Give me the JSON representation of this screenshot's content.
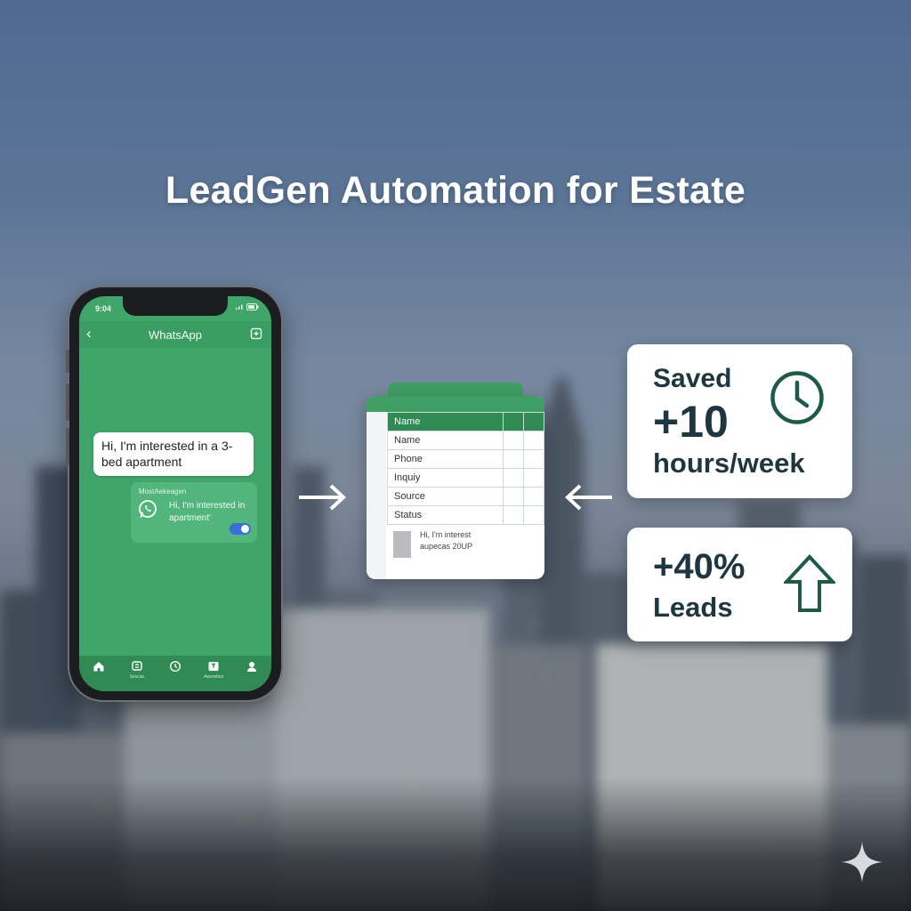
{
  "title": "LeadGen Automation for Estate",
  "phone": {
    "status_time": "9:04",
    "app_title": "WhatsApp",
    "incoming_message": "Hi, I'm interested in a 3-bed apartment",
    "outgoing_sender": "MostAekeagen",
    "outgoing_message": "Hi, I'm interested in apartment'",
    "nav_items": [
      {
        "icon": "home-icon",
        "label": ""
      },
      {
        "icon": "chats-icon",
        "label": "Sescas"
      },
      {
        "icon": "clock-icon",
        "label": ""
      },
      {
        "icon": "archive-icon",
        "label": "Awenetos"
      },
      {
        "icon": "profile-icon",
        "label": ""
      }
    ]
  },
  "sheet": {
    "header": "Name",
    "rows": [
      "Name",
      "Phone",
      "Inquiy",
      "Source",
      "Status"
    ],
    "footer_line1": "Hi, I'm interest",
    "footer_line2": "aupecas 20UP"
  },
  "stat_time": {
    "label_top": "Saved",
    "value": "+10",
    "label_bottom": "hours/week",
    "icon": "clock-icon"
  },
  "stat_leads": {
    "value": "+40%",
    "label": "Leads",
    "icon": "up-arrow-icon"
  },
  "colors": {
    "green": "#3fa568",
    "dark_green": "#2f8a53",
    "icon_green": "#1e5a48",
    "text_dark": "#1d3640"
  }
}
